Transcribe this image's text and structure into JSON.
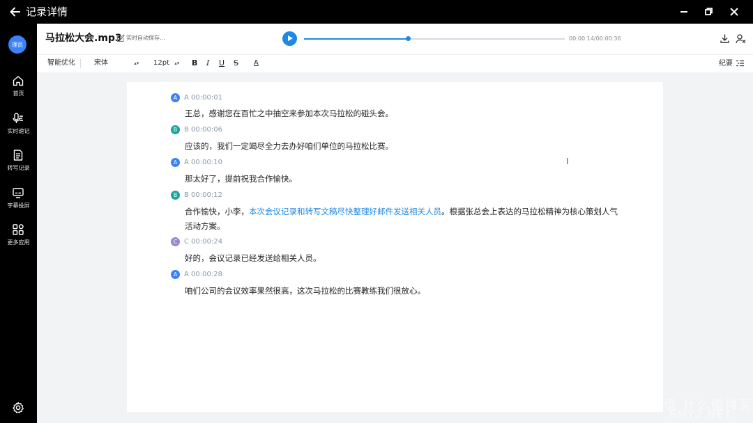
{
  "window": {
    "title": "记录详情"
  },
  "sidebar": {
    "avatar_text": "理员",
    "items": [
      {
        "label": "首页",
        "icon": "home-icon"
      },
      {
        "label": "实时速记",
        "icon": "microphone-icon"
      },
      {
        "label": "转写记录",
        "icon": "document-icon"
      },
      {
        "label": "字幕投屏",
        "icon": "screen-cast-icon"
      },
      {
        "label": "更多应用",
        "icon": "apps-grid-icon"
      }
    ],
    "settings_icon": "gear-icon"
  },
  "header": {
    "file_title": "马拉松大会.mp3",
    "autosave": "实时自动保存...",
    "time": "00:00:14/00:00:36",
    "progress": 0.4,
    "accent_color": "#1e88e5"
  },
  "toolbar": {
    "smart_optimize": "智能优化",
    "font_family": "宋体",
    "font_size": "12pt",
    "bold": "B",
    "italic": "I",
    "underline": "U",
    "strike": "S",
    "font_color": "A",
    "summary": "纪要"
  },
  "transcript": [
    {
      "speaker": "A",
      "stamp": "A 00:00:01",
      "color": "#3b82f6",
      "text": "王总，感谢您在百忙之中抽空来参加本次马拉松的碰头会。"
    },
    {
      "speaker": "B",
      "stamp": "B 00:00:06",
      "color": "#1ba39c",
      "text": "应该的，我们一定竭尽全力去办好咱们单位的马拉松比赛。"
    },
    {
      "speaker": "A",
      "stamp": "A 00:00:10",
      "color": "#3b82f6",
      "text": "那太好了，提前祝我合作愉快。"
    },
    {
      "speaker": "B",
      "stamp": "B 00:00:12",
      "color": "#1ba39c",
      "text_pre": "合作愉快，小李，",
      "text_hl": "本次会议记录和转写文稿尽快整理好邮件发送相关人员",
      "text_post": "。根据张总会上表达的马拉松精神为核心策划人气活动方案。"
    },
    {
      "speaker": "C",
      "stamp": "C 00:00:24",
      "color": "#9b87d0",
      "text": "好的，会议记录已经发送给相关人员。"
    },
    {
      "speaker": "A",
      "stamp": "A 00:00:28",
      "color": "#3b82f6",
      "text": "咱们公司的会议效率果然很高，这次马拉松的比赛教练我们很放心。"
    }
  ],
  "watermark": {
    "zh": "值 什么值得买",
    "en": "SMYZ.NET"
  }
}
